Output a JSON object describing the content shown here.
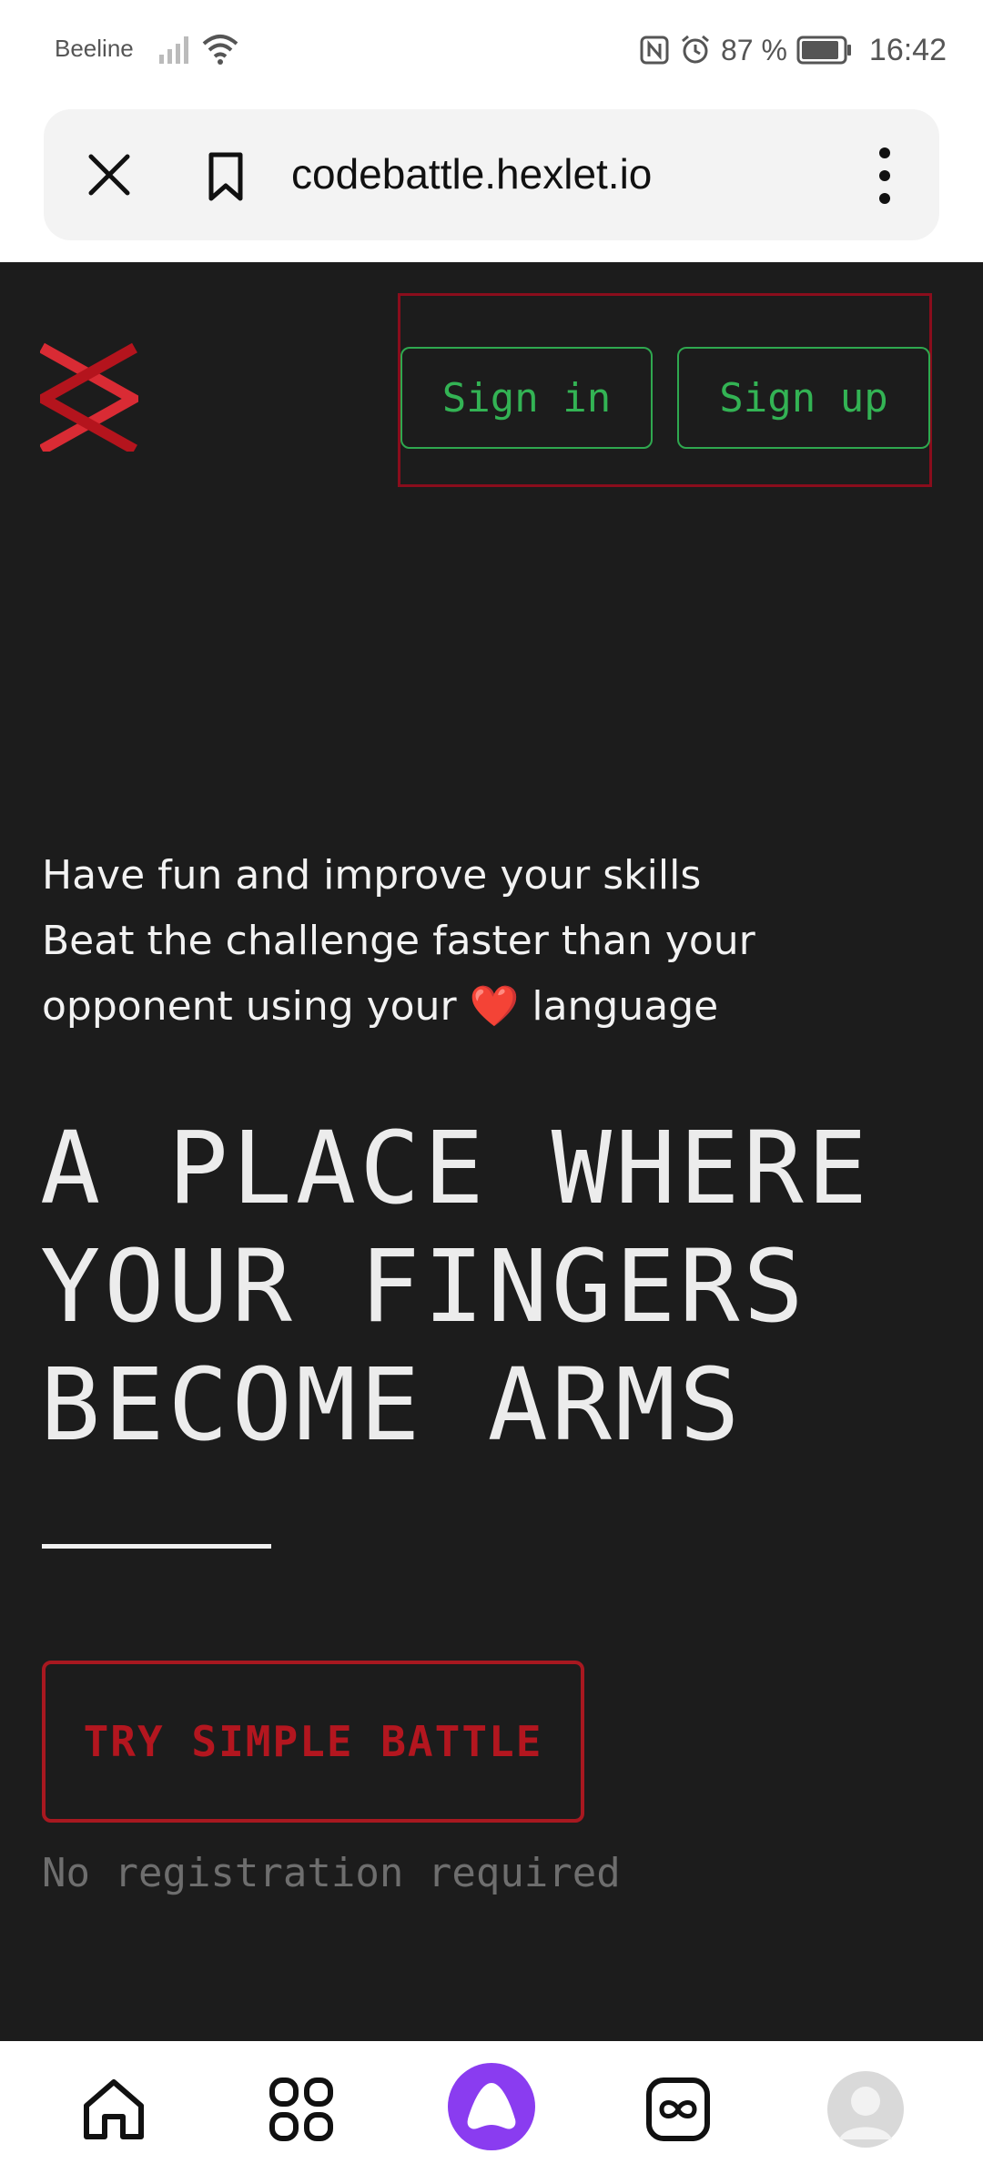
{
  "status_bar": {
    "carrier": "Beeline",
    "battery_percent": "87 %",
    "time": "16:42"
  },
  "browser": {
    "url": "codebattle.hexlet.io"
  },
  "header": {
    "signin_label": "Sign in",
    "signup_label": "Sign up"
  },
  "hero": {
    "tagline_lines": [
      "Have fun and improve your skills",
      "Beat the challenge faster than your",
      "opponent using your",
      "language"
    ],
    "heart": "❤️",
    "headline_lines": [
      "A PLACE WHERE",
      "YOUR FINGERS",
      "BECOME ARMS"
    ],
    "try_button_label": "TRY SIMPLE BATTLE",
    "note": "No registration required"
  },
  "colors": {
    "background": "#1c1c1c",
    "accent_green": "#33b354",
    "accent_red": "#b3161f",
    "assistant_purple": "#8a3cf0"
  }
}
